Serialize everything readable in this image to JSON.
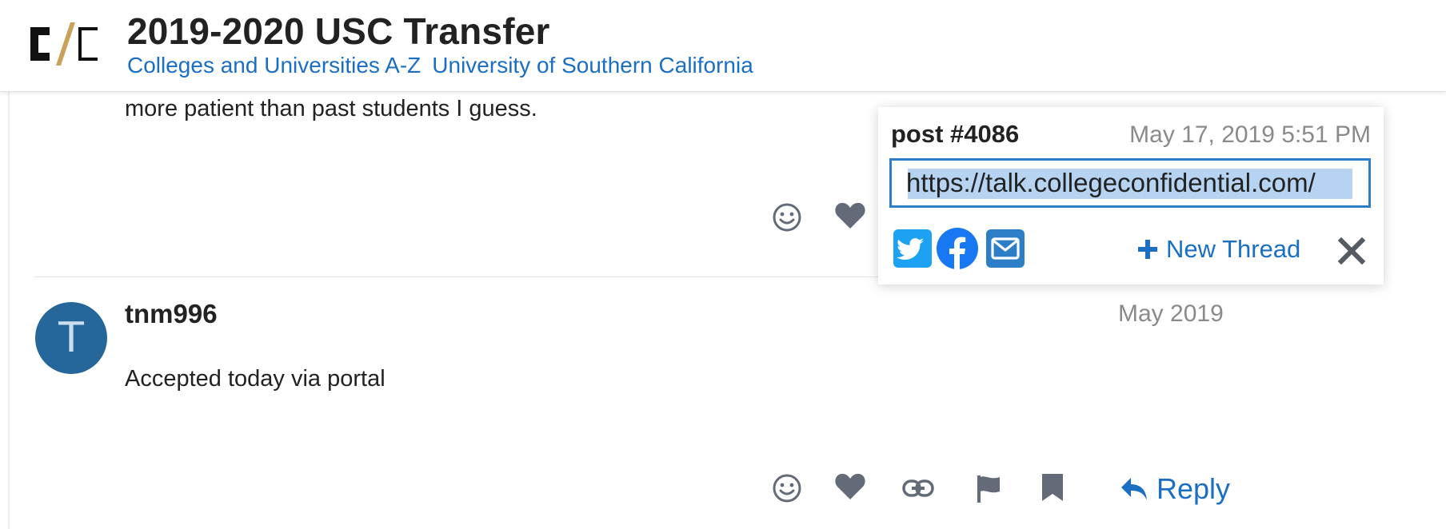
{
  "header": {
    "title": "2019-2020 USC Transfer",
    "breadcrumbs": [
      "Colleges and Universities A-Z",
      "University of Southern California"
    ],
    "logo_icon": "college-confidential-logo"
  },
  "posts": [
    {
      "text_tail": "more patient than past students I guess."
    },
    {
      "avatar_letter": "T",
      "username": "tnm996",
      "date": "May 2019",
      "text": "Accepted today via portal",
      "reply_label": "Reply"
    }
  ],
  "share_popup": {
    "title": "post #4086",
    "date": "May 17, 2019 5:51 PM",
    "url": "https://talk.collegeconfidential.com/",
    "new_thread_label": "New Thread",
    "icons": [
      "twitter-icon",
      "facebook-icon",
      "email-icon",
      "close-icon"
    ]
  },
  "colors": {
    "link": "#1a6fc4",
    "avatar": "#25679a",
    "icon_gray": "#646b78",
    "twitter": "#1da1f2",
    "facebook": "#1877f2",
    "email": "#2c7ec6"
  }
}
